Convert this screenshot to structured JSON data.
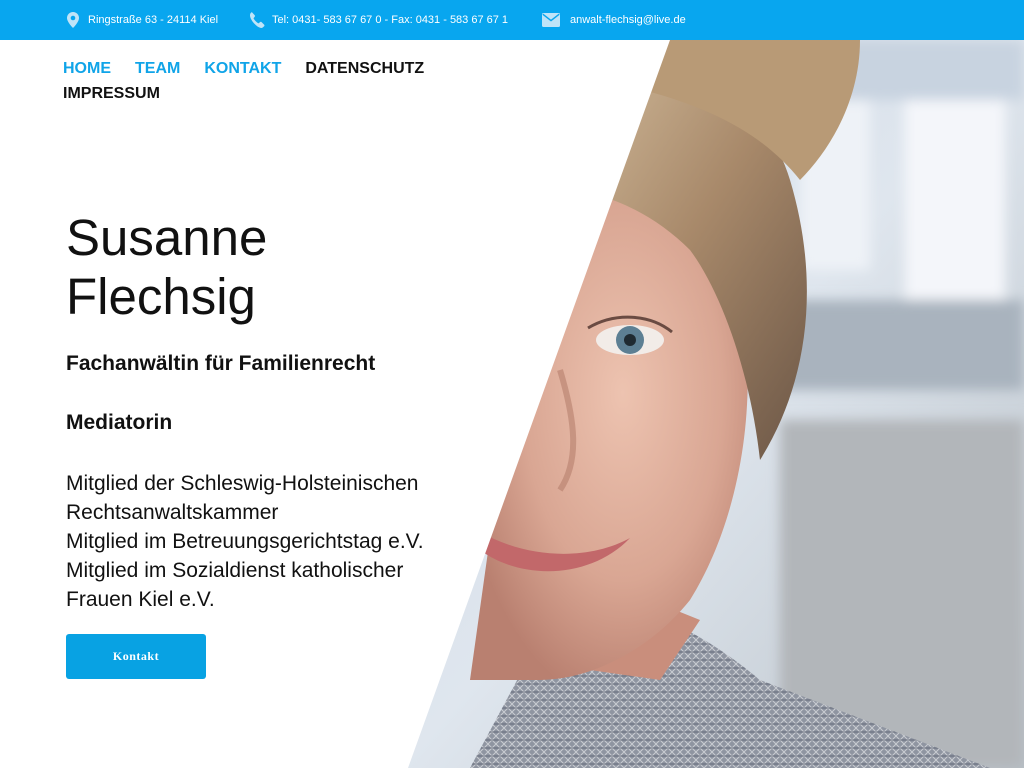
{
  "topbar": {
    "address": "Ringstraße 63 - 24114 Kiel",
    "phone": "Tel: 0431- 583 67 67 0 - Fax: 0431 - 583 67 67 1",
    "email": "anwalt-flechsig@live.de"
  },
  "nav": {
    "items": [
      {
        "label": "HOME"
      },
      {
        "label": "TEAM"
      },
      {
        "label": "KONTAKT"
      },
      {
        "label": "DATENSCHUTZ"
      },
      {
        "label": "IMPRESSUM"
      }
    ]
  },
  "hero": {
    "name_line1": "Susanne",
    "name_line2": "Flechsig",
    "subtitle1": "Fachanwältin für Familienrecht",
    "subtitle2": "Mediatorin",
    "members": [
      "Mitglied der Schleswig-Holsteinischen",
      "Rechtsanwaltskammer",
      "Mitglied im Betreuungsgerichtstag e.V.",
      "Mitglied im Sozialdienst katholischer",
      "Frauen Kiel e.V."
    ],
    "button_label": "Kontakt"
  },
  "colors": {
    "topbar": "#08a6ef",
    "nav_active": "#10a4e8",
    "button": "#08a2e3",
    "text": "#111111"
  },
  "icons": {
    "address": "map-pin-icon",
    "phone": "phone-icon",
    "email": "envelope-icon"
  }
}
